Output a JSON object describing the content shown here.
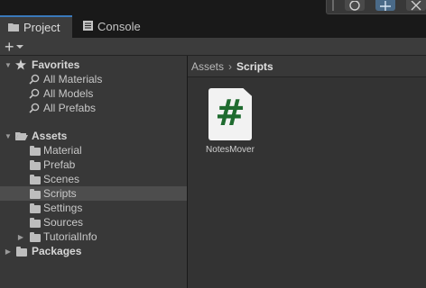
{
  "tabs": [
    {
      "label": "Project",
      "icon": "folder-icon",
      "active": true
    },
    {
      "label": "Console",
      "icon": "console-icon",
      "active": false
    }
  ],
  "toolbar": {
    "add_label": "+",
    "add_icon": "chevron-down-icon"
  },
  "favorites": {
    "label": "Favorites",
    "items": [
      "All Materials",
      "All Models",
      "All Prefabs"
    ]
  },
  "assets": {
    "label": "Assets",
    "folders": [
      "Material",
      "Prefab",
      "Scenes",
      "Scripts",
      "Settings",
      "Sources",
      "TutorialInfo"
    ],
    "selected": "Scripts"
  },
  "packages": {
    "label": "Packages"
  },
  "breadcrumb": {
    "root": "Assets",
    "current": "Scripts"
  },
  "files": [
    {
      "name": "NotesMover",
      "icon": "csharp-script-icon"
    }
  ],
  "colors": {
    "accent": "#3a79bb",
    "script_hash": "#1f6b2f"
  }
}
